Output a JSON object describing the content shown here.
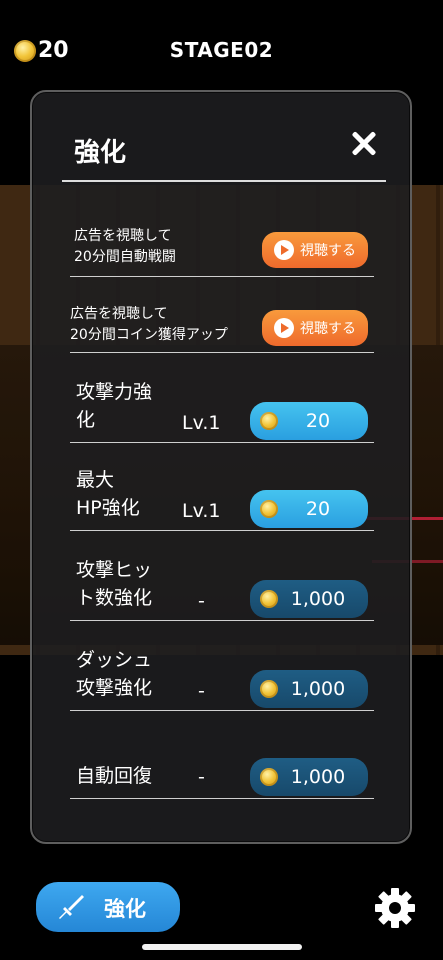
{
  "status": {
    "coins": "20",
    "stage": "STAGE02"
  },
  "panel": {
    "title": "強化",
    "ads": [
      {
        "line1": "広告を視聴して",
        "line2": "20分間自動戦闘",
        "button": "視聴する"
      },
      {
        "line1": "広告を視聴して",
        "line2": "20分間コイン獲得アップ",
        "button": "視聴する"
      }
    ],
    "upgrades": [
      {
        "line1": "攻撃力強",
        "line2": "化",
        "level": "Lv.1",
        "price": "20",
        "state": "active"
      },
      {
        "line1": "最大",
        "line2": "HP強化",
        "level": "Lv.1",
        "price": "20",
        "state": "active"
      },
      {
        "line1": "攻撃ヒッ",
        "line2": "ト数強化",
        "level": "-",
        "price": "1,000",
        "state": "inactive"
      },
      {
        "line1": "ダッシュ",
        "line2": "攻撃強化",
        "level": "-",
        "price": "1,000",
        "state": "inactive"
      },
      {
        "line1": "自動回復",
        "level": "-",
        "price": "1,000",
        "state": "inactive"
      }
    ]
  },
  "bottom": {
    "enhance_label": "強化"
  },
  "colors": {
    "active_button": "#3bb6ec",
    "inactive_button": "#1b5479",
    "ad_button": "#f27a2f",
    "coin": "#f2c53a"
  },
  "icons": [
    "coin-icon",
    "close-icon",
    "play-icon",
    "sword-icon",
    "gear-icon"
  ]
}
